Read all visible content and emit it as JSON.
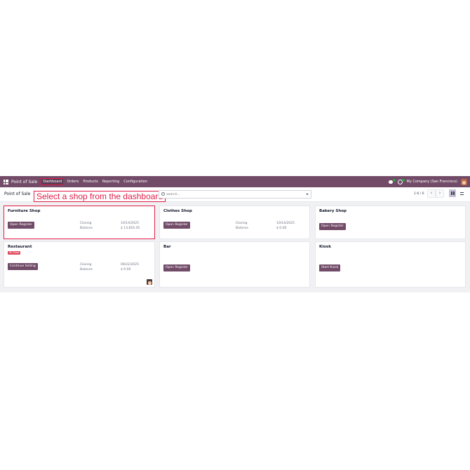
{
  "navbar": {
    "app_name": "Point of Sale",
    "menu": [
      "Dashboard",
      "Orders",
      "Products",
      "Reporting",
      "Configuration"
    ],
    "active_menu": "Dashboard",
    "company": "My Company (San Francisco)",
    "icons": [
      "apps-grid-icon",
      "chat-icon",
      "activity-clock-icon",
      "user-avatar"
    ]
  },
  "control": {
    "breadcrumb": "Point of Sale",
    "annotation": "Select a shop from the dashboard",
    "search_placeholder": "Search...",
    "pager": "1-6 / 6",
    "prev": "‹",
    "next": "›"
  },
  "cards": [
    {
      "title": "Furniture Shop",
      "button": "Open Register",
      "closing_label": "Closing",
      "balance_label": "Balance",
      "closing": "10/14/2025",
      "balance": "$ 13,816.45"
    },
    {
      "title": "Clothes Shop",
      "button": "Open Register",
      "closing_label": "Closing",
      "balance_label": "Balance",
      "closing": "10/14/2025",
      "balance": "$ 0.00"
    },
    {
      "title": "Bakery Shop",
      "button": "Open Register"
    },
    {
      "title": "Restaurant",
      "badge": "To Close",
      "button": "Continue Selling",
      "closing_label": "Closing",
      "balance_label": "Balance",
      "closing": "09/22/2025",
      "balance": "$ 0.00"
    },
    {
      "title": "Bar",
      "button": "Open Register"
    },
    {
      "title": "Kiosk",
      "button": "Start Kiosk"
    }
  ],
  "colors": {
    "brand": "#714b67",
    "highlight": "#e11d48",
    "badge": "#e14b5d"
  }
}
